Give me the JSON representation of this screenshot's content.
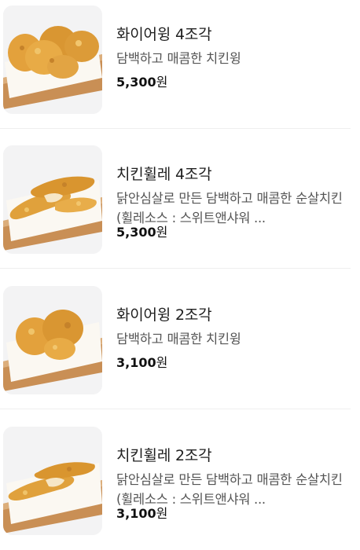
{
  "menu": {
    "items": [
      {
        "name": "화이어윙 4조각",
        "description": "담백하고 매콤한 치킨윙",
        "price_number": "5,300",
        "price_unit": "원",
        "image": "fire-wing-image"
      },
      {
        "name": "치킨휠레 4조각",
        "description": "닭안심살로 만든 담백하고 매콤한 순살치킨 (휠레소스 : 스위트앤샤워 ...",
        "price_number": "5,300",
        "price_unit": "원",
        "image": "chicken-fillet-image"
      },
      {
        "name": "화이어윙 2조각",
        "description": "담백하고 매콤한 치킨윙",
        "price_number": "3,100",
        "price_unit": "원",
        "image": "fire-wing-image"
      },
      {
        "name": "치킨휠레 2조각",
        "description": "닭안심살로 만든 담백하고 매콤한 순살치킨 (휠레소스 : 스위트앤샤워 ...",
        "price_number": "3,100",
        "price_unit": "원",
        "image": "chicken-fillet-image"
      }
    ]
  },
  "colors": {
    "thumb_background": "#f3f3f4",
    "board_wood": "#c98f55",
    "paper": "#fbf8f2",
    "fried_golden": "#e3a13c"
  }
}
